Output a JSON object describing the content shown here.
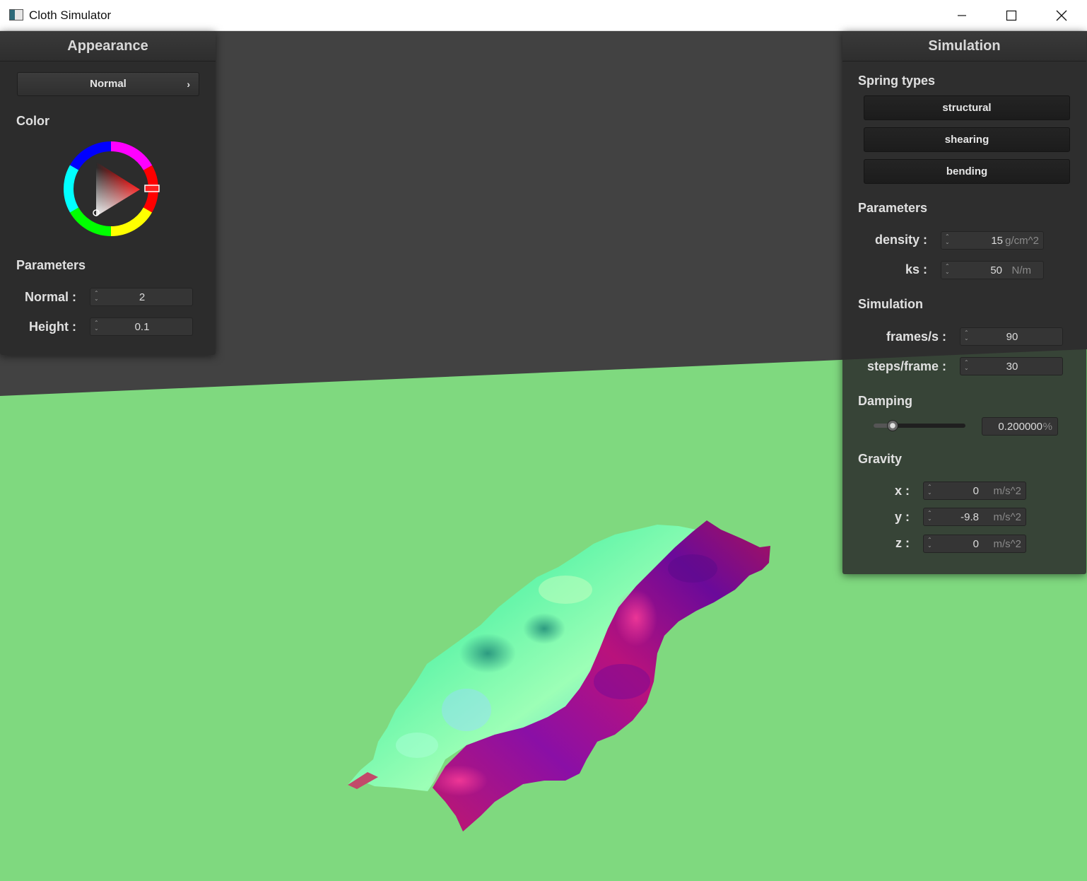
{
  "window": {
    "title": "Cloth Simulator"
  },
  "appearance": {
    "header": "Appearance",
    "shader_select": "Normal",
    "color_label": "Color",
    "params_label": "Parameters",
    "normal_label": "Normal :",
    "normal_value": "2",
    "height_label": "Height :",
    "height_value": "0.1"
  },
  "simulation": {
    "header": "Simulation",
    "spring_types_label": "Spring types",
    "spring_buttons": [
      "structural",
      "shearing",
      "bending"
    ],
    "params_label": "Parameters",
    "density_label": "density :",
    "density_value": "15",
    "density_unit": "g/cm^2",
    "ks_label": "ks :",
    "ks_value": "50",
    "ks_unit": "N/m",
    "sim_label": "Simulation",
    "fps_label": "frames/s :",
    "fps_value": "90",
    "steps_label": "steps/frame :",
    "steps_value": "30",
    "damping_label": "Damping",
    "damping_value": "0.200000",
    "damping_unit": "%",
    "damping_fraction": 0.2,
    "gravity_label": "Gravity",
    "gx_label": "x :",
    "gx_value": "0",
    "gy_label": "y :",
    "gy_value": "-9.8",
    "gz_label": "z :",
    "gz_value": "0",
    "gravity_unit": "m/s^2"
  },
  "colors": {
    "background": "#424242",
    "ground": "#7fd97f",
    "cloth_green": "#7dff8c",
    "cloth_magenta": "#a0179a",
    "selected_color": "#ff0000"
  }
}
